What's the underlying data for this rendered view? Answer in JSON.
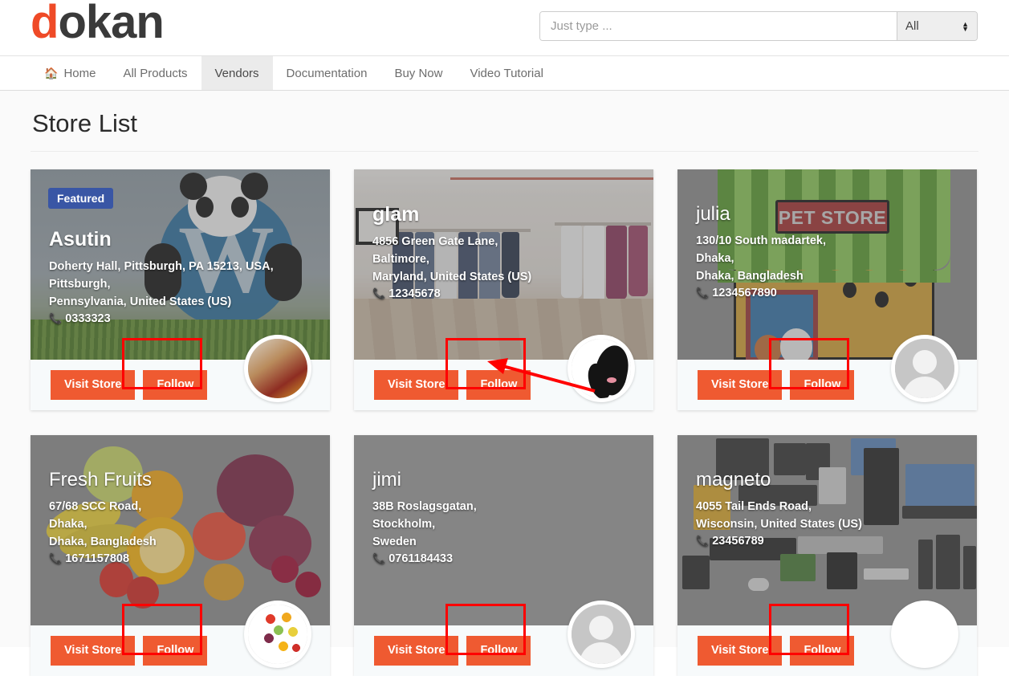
{
  "header": {
    "logo": {
      "accent": "d",
      "rest": "okan",
      "accent_color": "#ef4a27"
    },
    "search": {
      "placeholder": "Just type ...",
      "value": "",
      "category_selected": "All"
    }
  },
  "nav": {
    "items": [
      {
        "label": "Home",
        "icon": "home-icon",
        "active": false
      },
      {
        "label": "All Products",
        "active": false
      },
      {
        "label": "Vendors",
        "active": true
      },
      {
        "label": "Documentation",
        "active": false
      },
      {
        "label": "Buy Now",
        "active": false
      },
      {
        "label": "Video Tutorial",
        "active": false
      }
    ]
  },
  "page": {
    "title": "Store List",
    "accent_color": "#ef5a31",
    "featured_badge_color": "#3956a5",
    "annotation_color": "#ff0000"
  },
  "buttons": {
    "visit_store": "Visit Store",
    "follow": "Follow"
  },
  "stores": [
    {
      "name": "Asutin",
      "featured": true,
      "featured_label": "Featured",
      "address_lines": [
        "Doherty Hall, Pittsburgh, PA 15213, USA,",
        "Pittsburgh,",
        "Pennsylvania, United States (US)"
      ],
      "phone": "0333323",
      "avatar": "photo",
      "banner": "panda-wordpress"
    },
    {
      "name": "glam",
      "featured": false,
      "address_lines": [
        "4856 Green Gate Lane,",
        "Baltimore,",
        "Maryland, United States (US)"
      ],
      "phone": "12345678",
      "avatar": "photo",
      "banner": "boutique",
      "has_arrow_annotation": true
    },
    {
      "name": "julia",
      "featured": false,
      "address_lines": [
        "130/10 South madartek,",
        "Dhaka,",
        "Dhaka, Bangladesh"
      ],
      "phone": "1234567890",
      "avatar": "person",
      "banner": "pet-store"
    },
    {
      "name": "Fresh Fruits",
      "featured": false,
      "address_lines": [
        "67/68 SCC Road,",
        "Dhaka,",
        "Dhaka, Bangladesh"
      ],
      "phone": "1671157808",
      "avatar": "photo",
      "banner": "fruits"
    },
    {
      "name": "jimi",
      "featured": false,
      "address_lines": [
        "38B Roslagsgatan,",
        "Stockholm,",
        "Sweden"
      ],
      "phone": "0761184433",
      "avatar": "person",
      "banner": "plain-grey"
    },
    {
      "name": "magneto",
      "featured": false,
      "address_lines": [
        "4055 Tail Ends Road,",
        "Wisconsin, United States (US)"
      ],
      "phone": "23456789",
      "avatar": "blank",
      "banner": "electronics"
    }
  ]
}
